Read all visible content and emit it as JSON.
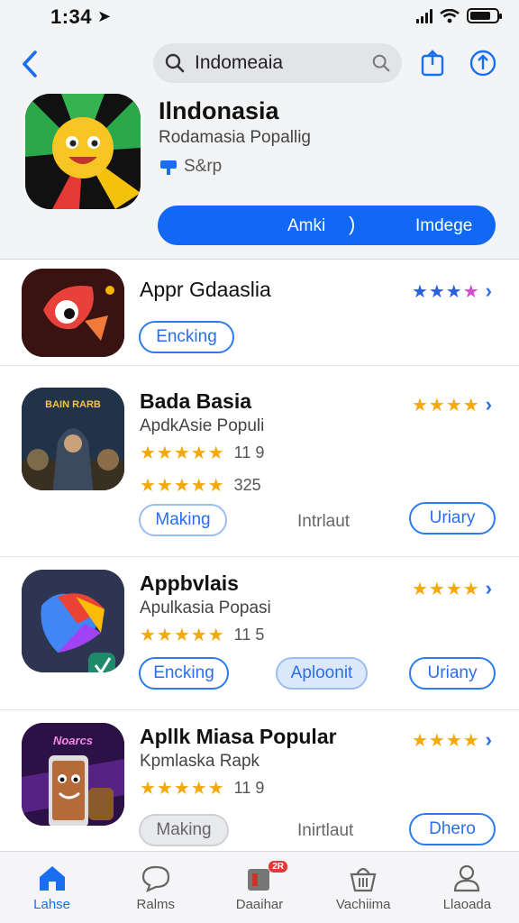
{
  "status": {
    "time": "1:34"
  },
  "search": {
    "value": "Indomeaia"
  },
  "featured": {
    "title": "Ilndonasia",
    "subtitle": "Rodamasia Popallig",
    "developer": "S&rp",
    "cta_left": "Amki",
    "cta_right": "Imdege"
  },
  "rows": [
    {
      "title": "Appr Gdaaslia",
      "button": "Encking",
      "rating_stars": 4
    },
    {
      "title": "Bada Basia",
      "subtitle": "ApdkAsie Populi",
      "ratings": [
        {
          "stars": 5,
          "count": "11 9"
        },
        {
          "stars": 5,
          "count": "325"
        }
      ],
      "button_left": "Making",
      "middle_text": "Intrlaut",
      "button_right": "Uriary",
      "rating_stars": 4,
      "icon_text": "BAIN RARB"
    },
    {
      "title": "Appbvlais",
      "subtitle": "Apulkasia Popasi",
      "ratings": [
        {
          "stars": 5,
          "count": "11 5"
        }
      ],
      "button_left": "Encking",
      "button_middle": "Aploonit",
      "button_right": "Uriany",
      "rating_stars": 4
    },
    {
      "title": "Apllk Miasa Popular",
      "subtitle": "Kpmlaska Rapk",
      "ratings": [
        {
          "stars": 5,
          "count": "11 9"
        }
      ],
      "button_left": "Making",
      "middle_text": "Inirtlaut",
      "button_right": "Dhero",
      "rating_stars": 4,
      "icon_text": "Noarcs"
    }
  ],
  "tabs": [
    {
      "label": "Lahse",
      "icon": "home-icon",
      "active": true
    },
    {
      "label": "Ralms",
      "icon": "chat-icon"
    },
    {
      "label": "Daaihar",
      "icon": "apps-icon",
      "badge": "2R"
    },
    {
      "label": "Vachiima",
      "icon": "basket-icon"
    },
    {
      "label": "Llaoada",
      "icon": "person-icon"
    }
  ],
  "colors": {
    "accent": "#1168f5",
    "star": "#f4a90b",
    "link": "#2a6ef0"
  }
}
